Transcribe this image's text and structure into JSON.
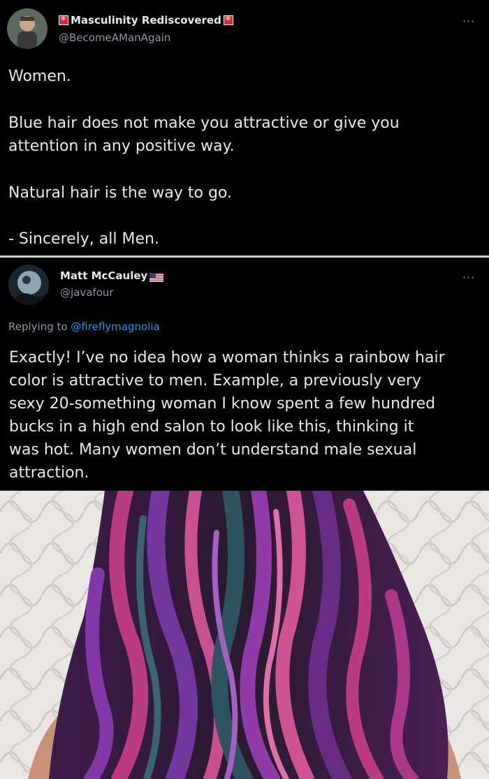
{
  "tweet1": {
    "display_name": "Masculinity Rediscovered",
    "handle": "@BecomeAManAgain",
    "more": "···",
    "lines": [
      "Women.",
      "Blue hair does not make you attractive or give you",
      "attention in any positive way.",
      "Natural hair is the way to go.",
      "- Sincerely, all Men."
    ]
  },
  "tweet2": {
    "display_name": "Matt McCauley",
    "handle": "@javafour",
    "more": "···",
    "reply_prefix": "Replying to ",
    "reply_to": "@fireflymagnolia",
    "lines": [
      "Exactly! I’ve no idea how a woman thinks a rainbow hair",
      "color is attractive to men. Example, a previously very",
      "sexy 20-something woman I know spent a few hundred",
      "bucks in a high end salon to look like this, thinking it",
      "was hot. Many women don’t understand male sexual",
      "attraction."
    ]
  },
  "colors": {
    "background": "#000000",
    "text": "#e7e9ea",
    "secondary": "#8b98a5",
    "link": "#1d9bf0"
  },
  "icons": [
    "red-emoji-icon",
    "us-flag-icon",
    "more-icon"
  ]
}
